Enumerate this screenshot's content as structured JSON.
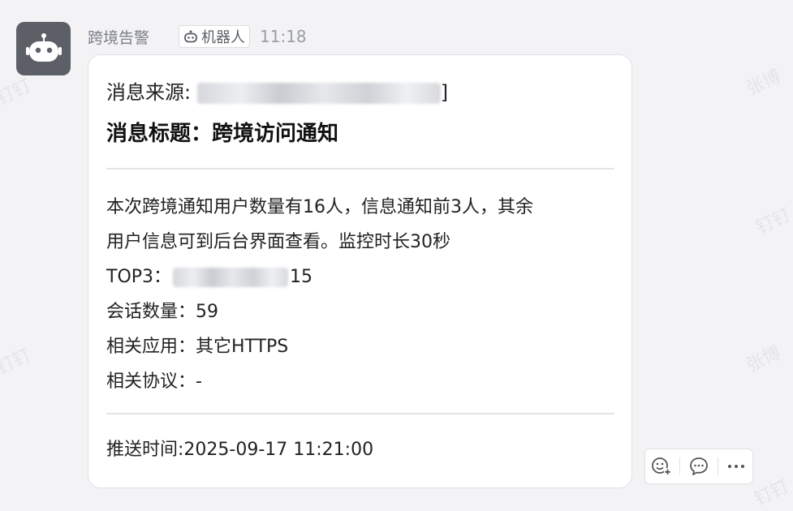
{
  "message": {
    "sender": "跨境告警",
    "bot_tag_label": "机器人",
    "time": "11:18"
  },
  "card": {
    "source_label": "消息来源: ",
    "source_tail": "]",
    "title": "消息标题：跨境访问通知",
    "body_line1": "本次跨境通知用户数量有16人，信息通知前3人，其余",
    "body_line2": "用户信息可到后台界面查看。监控时长30秒",
    "top3_label": "TOP3：",
    "top3_tail": "15",
    "sessions": "会话数量：59",
    "app": "相关应用：其它HTTPS",
    "protocol": "相关协议：-",
    "push_time": "推送时间:2025-09-17 11:21:00"
  },
  "icons": [
    "robot-icon",
    "emoji-add-icon",
    "comment-icon",
    "more-icon"
  ],
  "colors": {
    "avatar_bg": "#5c5f66",
    "card_bg": "#ffffff",
    "page_bg": "#f3f3f5"
  }
}
